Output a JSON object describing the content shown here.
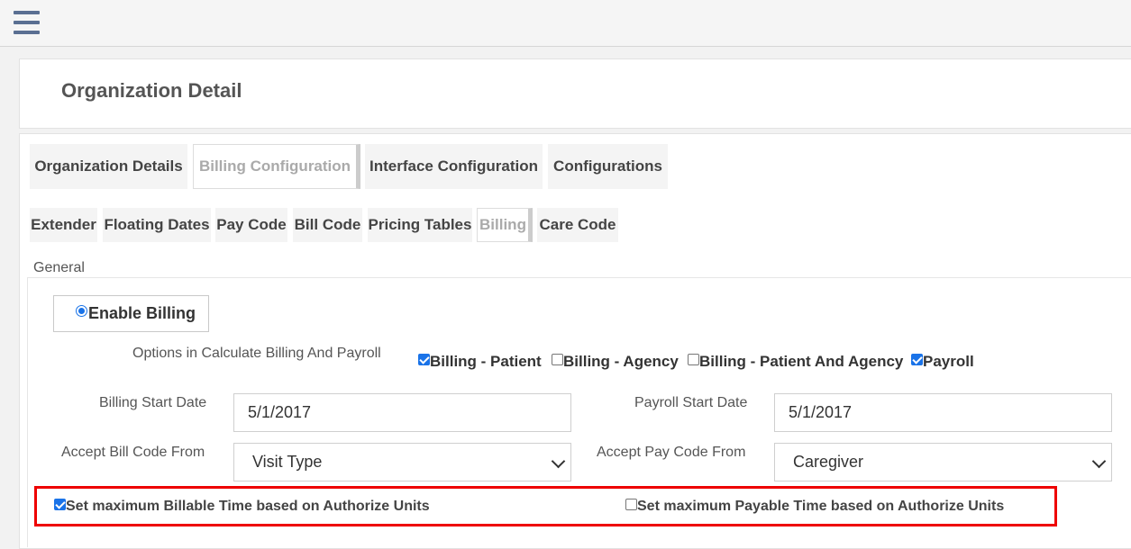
{
  "header": {
    "title": "Organization Detail"
  },
  "main_tabs": [
    {
      "label": "Organization Details"
    },
    {
      "label": "Billing Configuration"
    },
    {
      "label": "Interface Configuration"
    },
    {
      "label": "Configurations"
    }
  ],
  "sub_tabs": [
    {
      "label": "Extender"
    },
    {
      "label": "Floating Dates"
    },
    {
      "label": "Pay Code"
    },
    {
      "label": "Bill Code"
    },
    {
      "label": "Pricing Tables"
    },
    {
      "label": "Billing"
    },
    {
      "label": "Care Code"
    }
  ],
  "general": {
    "section_label": "General",
    "enable_billing_label": "Enable Billing",
    "options_label": "Options in Calculate Billing And Payroll",
    "options": [
      {
        "label": "Billing - Patient",
        "checked": true
      },
      {
        "label": "Billing - Agency",
        "checked": false
      },
      {
        "label": "Billing - Patient And Agency",
        "checked": false
      },
      {
        "label": "Payroll",
        "checked": true
      }
    ],
    "billing_start_label": "Billing Start Date",
    "billing_start_value": "5/1/2017",
    "payroll_start_label": "Payroll Start Date",
    "payroll_start_value": "5/1/2017",
    "bill_code_from_label": "Accept Bill Code From",
    "bill_code_from_value": "Visit Type",
    "pay_code_from_label": "Accept Pay Code From",
    "pay_code_from_value": "Caregiver",
    "max_billable_label": "Set maximum Billable Time based on Authorize Units",
    "max_billable_checked": true,
    "max_payable_label": "Set maximum Payable Time based on Authorize Units",
    "max_payable_checked": false
  },
  "colors": {
    "accent": "#1a73e8",
    "highlight": "#ee0000"
  }
}
